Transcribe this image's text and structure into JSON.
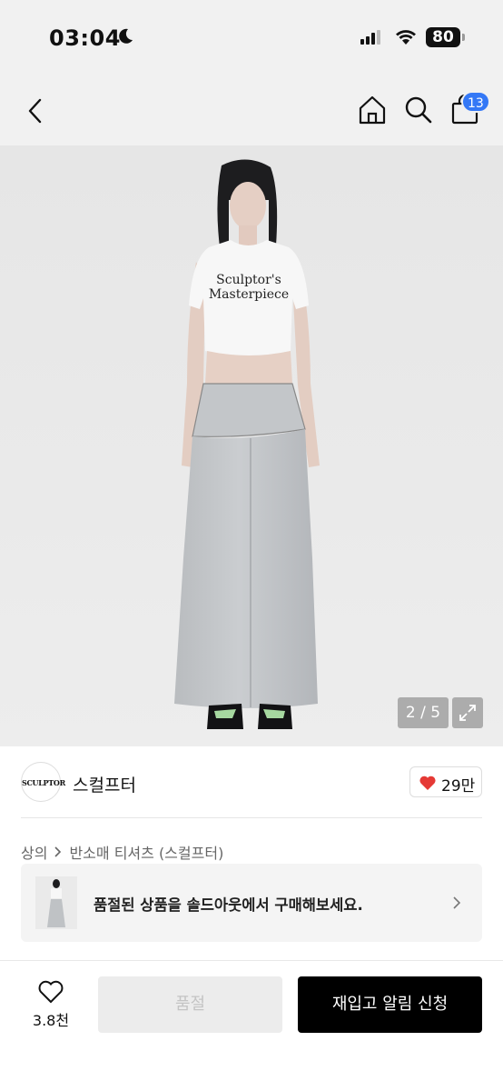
{
  "status": {
    "time": "03:04",
    "battery": "80"
  },
  "nav": {
    "cart_badge": "13"
  },
  "gallery": {
    "counter": "2 / 5",
    "shirt_print": "Sculptor's Masterpiece"
  },
  "brand": {
    "logo_text": "SCULPTOR",
    "name": "스컬프터",
    "likes": "29만"
  },
  "breadcrumb": {
    "category": "상의",
    "subcategory": "반소매 티셔츠 (스컬프터)"
  },
  "banner": {
    "text": "품절된 상품을 솔드아웃에서 구매해보세요."
  },
  "bottom": {
    "wish_count": "3.8천",
    "soldout_label": "품절",
    "restock_label": "재입고 알림 신청"
  },
  "colors": {
    "accent_blue": "#3478f6",
    "heart_red": "#e53935",
    "cta_black": "#000000"
  }
}
